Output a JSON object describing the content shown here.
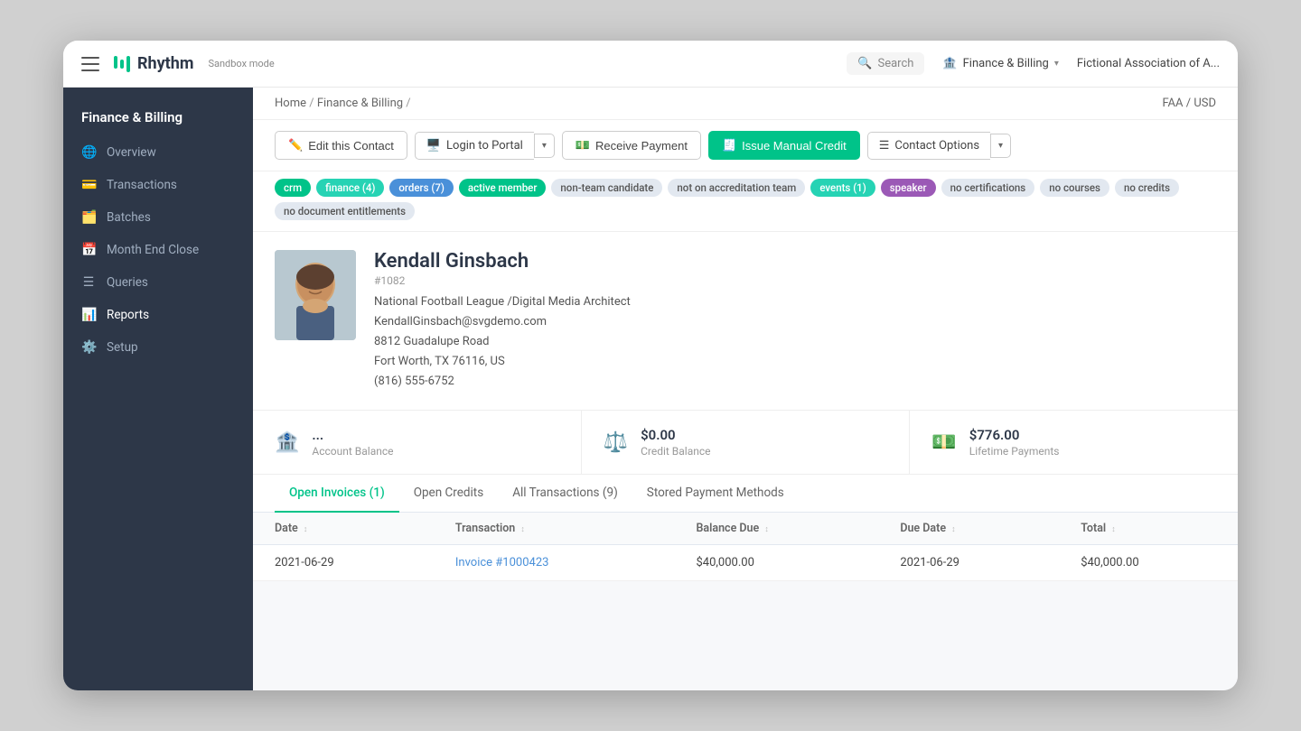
{
  "topbar": {
    "logo_text": "Rhythm",
    "sandbox_label": "Sandbox mode",
    "search_placeholder": "Search",
    "nav_finance": "Finance & Billing",
    "org_name": "Fictional Association of A..."
  },
  "sidebar": {
    "section_title": "Finance & Billing",
    "items": [
      {
        "id": "overview",
        "label": "Overview",
        "icon": "🌐"
      },
      {
        "id": "transactions",
        "label": "Transactions",
        "icon": "💳"
      },
      {
        "id": "batches",
        "label": "Batches",
        "icon": "🗂️"
      },
      {
        "id": "month-end-close",
        "label": "Month End Close",
        "icon": "📅"
      },
      {
        "id": "queries",
        "label": "Queries",
        "icon": "☰"
      },
      {
        "id": "reports",
        "label": "Reports",
        "icon": "📊"
      },
      {
        "id": "setup",
        "label": "Setup",
        "icon": "⚙️"
      }
    ]
  },
  "breadcrumb": {
    "home": "Home",
    "section": "Finance & Billing",
    "separator": "/"
  },
  "faa_badge": "FAA / USD",
  "actions": {
    "edit_contact": "Edit this Contact",
    "login_portal": "Login to Portal",
    "receive_payment": "Receive Payment",
    "issue_credit": "Issue Manual Credit",
    "contact_options": "Contact Options"
  },
  "tags": [
    {
      "label": "crm",
      "color": "green"
    },
    {
      "label": "finance (4)",
      "color": "teal"
    },
    {
      "label": "orders (7)",
      "color": "blue"
    },
    {
      "label": "active member",
      "color": "green"
    },
    {
      "label": "non-team candidate",
      "color": "gray"
    },
    {
      "label": "not on accreditation team",
      "color": "gray"
    },
    {
      "label": "events (1)",
      "color": "teal"
    },
    {
      "label": "speaker",
      "color": "purple"
    },
    {
      "label": "no certifications",
      "color": "gray"
    },
    {
      "label": "no courses",
      "color": "gray"
    },
    {
      "label": "no credits",
      "color": "gray"
    },
    {
      "label": "no document entitlements",
      "color": "gray"
    }
  ],
  "profile": {
    "name": "Kendall Ginsbach",
    "id": "#1082",
    "organization": "National Football League /Digital Media Architect",
    "email": "KendallGinsbach@svgdemo.com",
    "address1": "8812 Guadalupe Road",
    "address2": "Fort Worth, TX 76116, US",
    "phone": "(816) 555-6752"
  },
  "stats": [
    {
      "icon": "🏦",
      "value": "...",
      "label": "Account Balance"
    },
    {
      "icon": "⚖️",
      "value": "$0.00",
      "label": "Credit Balance"
    },
    {
      "icon": "💵",
      "value": "$776.00",
      "label": "Lifetime Payments"
    }
  ],
  "tabs": [
    {
      "id": "open-invoices",
      "label": "Open Invoices (1)",
      "active": true
    },
    {
      "id": "open-credits",
      "label": "Open Credits"
    },
    {
      "id": "all-transactions",
      "label": "All Transactions (9)"
    },
    {
      "id": "stored-payments",
      "label": "Stored Payment Methods"
    }
  ],
  "table": {
    "columns": [
      {
        "id": "date",
        "label": "Date ↕"
      },
      {
        "id": "transaction",
        "label": "Transaction ↕"
      },
      {
        "id": "balance-due",
        "label": "Balance Due ↕"
      },
      {
        "id": "due-date",
        "label": "Due Date ↕"
      },
      {
        "id": "total",
        "label": "Total ↕"
      }
    ],
    "rows": [
      {
        "date": "2021-06-29",
        "transaction": "Invoice #1000423",
        "transaction_link": true,
        "balance_due": "$40,000.00",
        "due_date": "2021-06-29",
        "total": "$40,000.00"
      }
    ]
  }
}
